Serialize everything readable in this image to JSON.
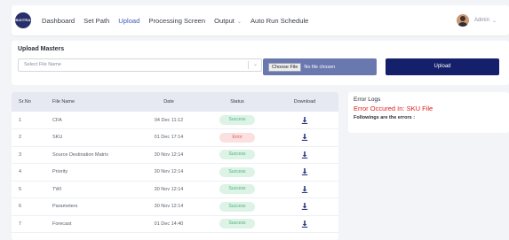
{
  "logo": {
    "text": "BIZITRA"
  },
  "nav": [
    {
      "label": "Dashboard",
      "active": false,
      "dropdown": false
    },
    {
      "label": "Set Path",
      "active": false,
      "dropdown": false
    },
    {
      "label": "Upload",
      "active": true,
      "dropdown": false
    },
    {
      "label": "Processing Screen",
      "active": false,
      "dropdown": false
    },
    {
      "label": "Output",
      "active": false,
      "dropdown": true
    },
    {
      "label": "Auto Run Schedule",
      "active": false,
      "dropdown": false
    }
  ],
  "user": {
    "name": "Admin"
  },
  "upload": {
    "title": "Upload Masters",
    "select_placeholder": "Select File Name",
    "choose_label": "Choose File",
    "file_status": "No file chosen",
    "button_label": "Upload"
  },
  "table": {
    "headers": {
      "sr": "Sr.No",
      "name": "File Name",
      "date": "Date",
      "status": "Status",
      "download": "Download"
    },
    "rows": [
      {
        "sr": "1",
        "name": "CFA",
        "date": "04 Dec 11:12",
        "status": "Success"
      },
      {
        "sr": "2",
        "name": "SKU",
        "date": "01 Dec 17:14",
        "status": "Error"
      },
      {
        "sr": "3",
        "name": "Source Destination Matrix",
        "date": "30 Nov 12:14",
        "status": "Success"
      },
      {
        "sr": "4",
        "name": "Priority",
        "date": "30 Nov 12:14",
        "status": "Success"
      },
      {
        "sr": "5",
        "name": "TWI",
        "date": "30 Nov 12:14",
        "status": "Success"
      },
      {
        "sr": "6",
        "name": "Parameters",
        "date": "30 Nov 12:14",
        "status": "Success"
      },
      {
        "sr": "7",
        "name": "Forecast",
        "date": "01 Dec 14:40",
        "status": "Success"
      }
    ]
  },
  "error_logs": {
    "title": "Error Logs",
    "message": "Error Occured In: SKU File",
    "subtitle": "Followings are the errors :"
  },
  "colors": {
    "accent": "#3f5bb6",
    "primary_button": "#15206b",
    "success_bg": "#dcf3e6",
    "success_text": "#4fb07f",
    "error_bg": "#fbe0e0",
    "error_text": "#e05a5a",
    "error_heading": "#e02020"
  },
  "icons": {
    "download": "download-icon",
    "dropdown": "chevron-down-icon"
  }
}
